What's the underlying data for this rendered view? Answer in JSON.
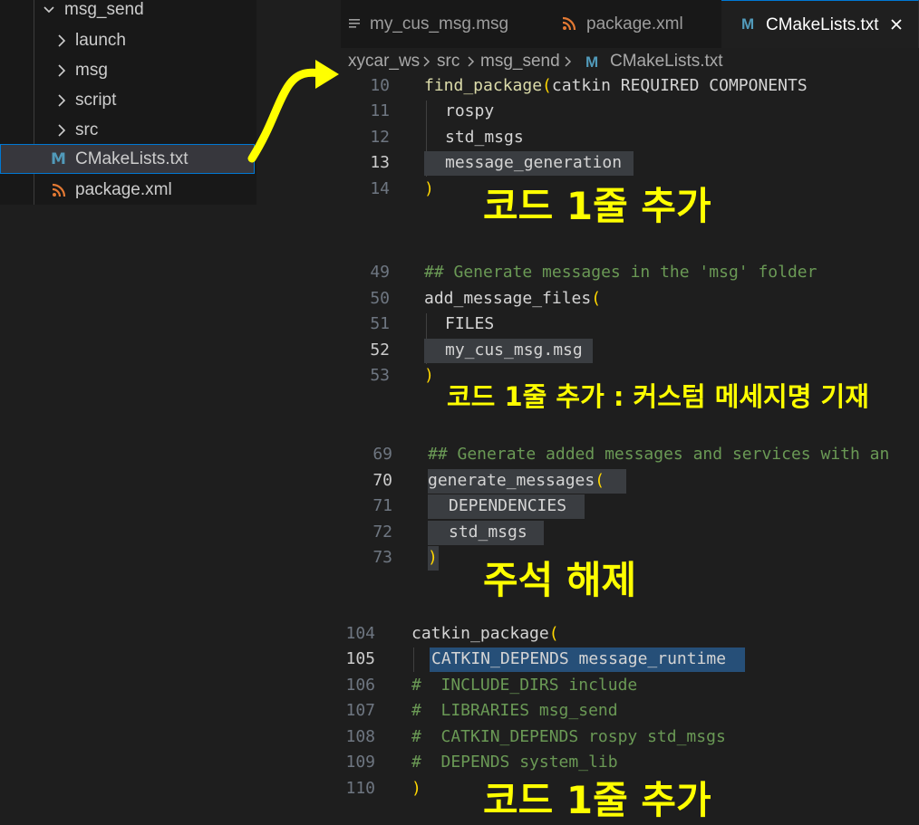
{
  "explorer": {
    "folder": "msg_send",
    "items": [
      {
        "label": "launch"
      },
      {
        "label": "msg"
      },
      {
        "label": "script"
      },
      {
        "label": "src"
      },
      {
        "label": "CMakeLists.txt",
        "icon": "M"
      },
      {
        "label": "package.xml"
      }
    ]
  },
  "tabs": [
    {
      "label": "my_cus_msg.msg"
    },
    {
      "label": "package.xml"
    },
    {
      "label": "CMakeLists.txt",
      "icon": "M"
    }
  ],
  "breadcrumb": [
    "xycar_ws",
    "src",
    "msg_send",
    "CMakeLists.txt"
  ],
  "breadcrumb_icon": "M",
  "code": {
    "block1": {
      "lines": [
        "10",
        "11",
        "12",
        "13",
        "14"
      ],
      "l10_fn": "find_package",
      "l10_args": "catkin REQUIRED COMPONENTS",
      "l11": "rospy",
      "l12": "std_msgs",
      "l13": "message_generation"
    },
    "block2": {
      "lines": [
        "49",
        "50",
        "51",
        "52",
        "53"
      ],
      "l49": "## Generate messages in the 'msg' folder",
      "l50_fn": "add_message_files",
      "l51": "FILES",
      "l52": "my_cus_msg.msg"
    },
    "block3": {
      "lines": [
        "69",
        "70",
        "71",
        "72",
        "73"
      ],
      "l69": "## Generate added messages and services with an",
      "l70_fn": "generate_messages",
      "l71": "DEPENDENCIES",
      "l72": "std_msgs"
    },
    "block4": {
      "lines": [
        "104",
        "105",
        "106",
        "107",
        "108",
        "109",
        "110"
      ],
      "l104_fn": "catkin_package",
      "l105": "CATKIN_DEPENDS message_runtime",
      "l106": "#  INCLUDE_DIRS include",
      "l107": "#  LIBRARIES msg_send",
      "l108": "#  CATKIN_DEPENDS rospy std_msgs",
      "l109": "#  DEPENDS system_lib"
    },
    "paren_open": "(",
    "paren_close": ")"
  },
  "annotations": {
    "note1": "코드 1줄 추가",
    "note2": "코드 1줄 추가 : 커스텀 메세지명 기재",
    "note3": "주석 해제",
    "note4": "코드 1줄 추가"
  },
  "colors": {
    "annotation": "#ffff00",
    "selection_outline": "#0078d4",
    "cmake_icon": "#519aba",
    "xml_icon": "#e37933"
  }
}
